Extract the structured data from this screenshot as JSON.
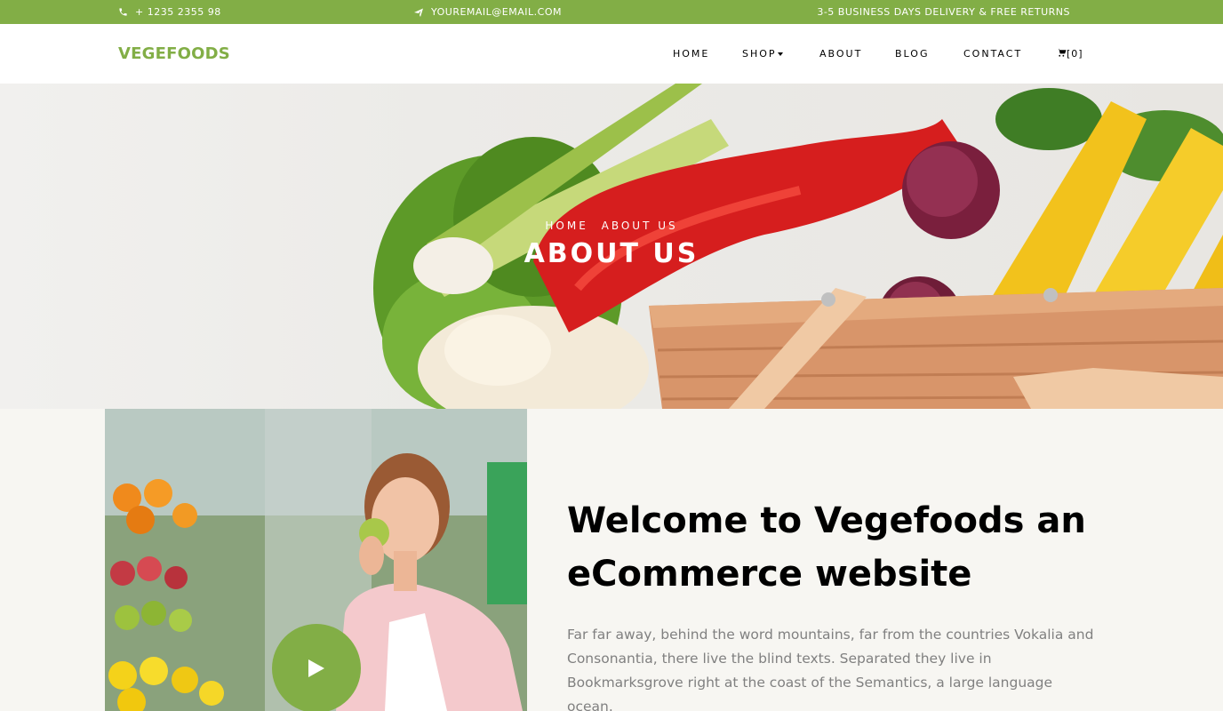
{
  "topbar": {
    "phone": "+ 1235 2355 98",
    "email": "YOUREMAIL@EMAIL.COM",
    "delivery": "3-5 BUSINESS DAYS DELIVERY & FREE RETURNS"
  },
  "navbar": {
    "brand": "VEGEFOODS",
    "items": [
      {
        "label": "HOME"
      },
      {
        "label": "SHOP"
      },
      {
        "label": "ABOUT"
      },
      {
        "label": "BLOG"
      },
      {
        "label": "CONTACT"
      }
    ],
    "cart_count": "[0]"
  },
  "hero": {
    "breadcrumb_home": "HOME",
    "breadcrumb_current": "ABOUT US",
    "title": "ABOUT US"
  },
  "about": {
    "heading": "Welcome to Vegefoods an eCommerce website",
    "text": "Far far away, behind the word mountains, far from the countries Vokalia and Consonantia, there live the blind texts. Separated they live in Bookmarksgrove right at the coast of the Semantics, a large language ocean."
  },
  "colors": {
    "brand": "#82ae46",
    "text_muted": "#808080"
  }
}
